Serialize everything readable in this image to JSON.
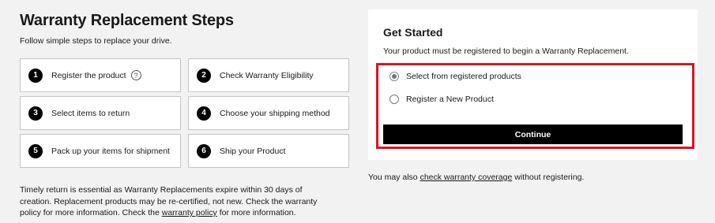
{
  "header": {
    "title": "Warranty Replacement Steps",
    "subtitle": "Follow simple steps to replace your drive."
  },
  "steps": [
    {
      "num": "1",
      "label": "Register the product",
      "help_icon": "question-circle-icon"
    },
    {
      "num": "2",
      "label": "Check Warranty Eligibility"
    },
    {
      "num": "3",
      "label": "Select items to return"
    },
    {
      "num": "4",
      "label": "Choose your shipping method"
    },
    {
      "num": "5",
      "label": "Pack up your items for shipment"
    },
    {
      "num": "6",
      "label": "Ship your Product"
    }
  ],
  "note": {
    "text_before": "Timely return is essential as Warranty Replacements expire within 30 days of creation. Replacement products may be re-certified, not new. Check the warranty policy for more information. Check the ",
    "link": "warranty policy",
    "text_after": " for more information."
  },
  "panel": {
    "title": "Get Started",
    "description": "Your product must be registered to begin a Warranty Replacement.",
    "options": [
      {
        "label": "Select from registered products",
        "checked": true
      },
      {
        "label": "Register a New Product",
        "checked": false
      }
    ],
    "continue_label": "Continue",
    "highlight_color": "#d91422"
  },
  "also": {
    "text_before": "You may also ",
    "link": "check warranty coverage",
    "text_after": " without registering."
  }
}
